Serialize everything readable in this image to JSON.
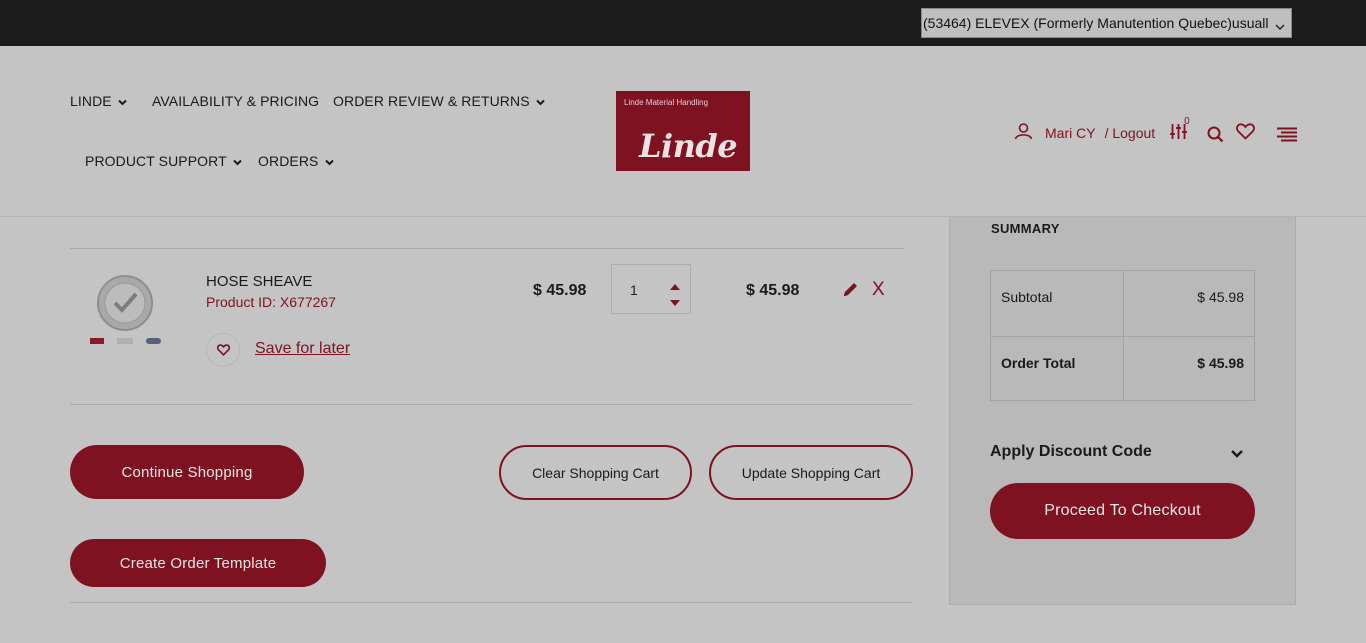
{
  "topbar": {
    "account_selector": "(53464) ELEVEX (Formerly Manutention Quebec)usuall"
  },
  "nav": {
    "linde": "LINDE",
    "availability": "AVAILABILITY & PRICING",
    "order_review": "ORDER REVIEW & RETURNS",
    "product_support": "PRODUCT SUPPORT",
    "orders": "ORDERS"
  },
  "logo": {
    "tagline": "Linde Material Handling",
    "wordmark": "Linde"
  },
  "user": {
    "name": "Mari CY",
    "logout": "/ Logout",
    "compare_count": "0",
    "icons": [
      "user-icon",
      "compare-icon",
      "search-icon",
      "heart-icon",
      "menu-icon"
    ]
  },
  "cart": {
    "items": [
      {
        "name": "HOSE SHEAVE",
        "product_id": "Product ID: X677267",
        "unit_price": "$ 45.98",
        "quantity": "1",
        "subtotal": "$ 45.98",
        "save_for_later": "Save for later"
      }
    ],
    "buttons": {
      "continue": "Continue Shopping",
      "clear": "Clear Shopping Cart",
      "update": "Update Shopping Cart",
      "template": "Create Order Template"
    }
  },
  "summary": {
    "title": "SUMMARY",
    "subtotal_label": "Subtotal",
    "subtotal_value": "$ 45.98",
    "total_label": "Order Total",
    "total_value": "$ 45.98",
    "discount_label": "Apply Discount Code",
    "checkout": "Proceed To Checkout"
  },
  "colors": {
    "brand": "#7e1221",
    "topbar": "#1c1c1c",
    "overlay_bg": "#c4c4c4"
  }
}
